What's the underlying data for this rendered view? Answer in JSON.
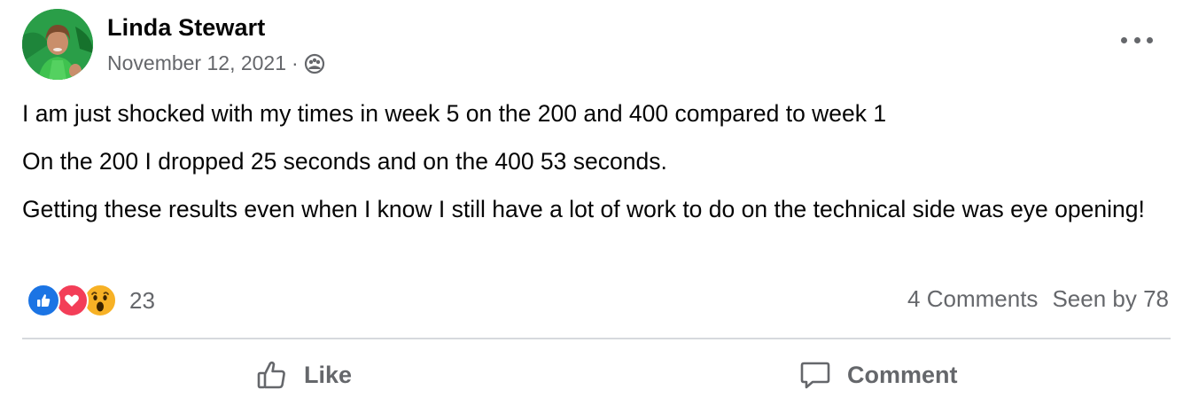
{
  "post": {
    "author": "Linda Stewart",
    "date": "November 12, 2021",
    "separator": "·",
    "privacy_icon": "group-icon",
    "paragraphs": [
      "I am just shocked with my times in week 5 on the 200 and 400 compared to week 1",
      "On the 200 I dropped 25 seconds and on the 400 53 seconds.",
      "Getting these results even when I know I still have a lot of work to do on the technical side was eye opening!"
    ]
  },
  "reactions": {
    "types": [
      "like-icon",
      "love-icon",
      "wow-icon"
    ],
    "count": "23"
  },
  "stats": {
    "comments": "4 Comments",
    "seen_by": "Seen by 78"
  },
  "actions": {
    "like_label": "Like",
    "comment_label": "Comment"
  },
  "colors": {
    "like_blue": "#1b74e4",
    "love_red": "#f33e58",
    "wow_yellow": "#f7b125",
    "secondary_text": "#65676b"
  }
}
